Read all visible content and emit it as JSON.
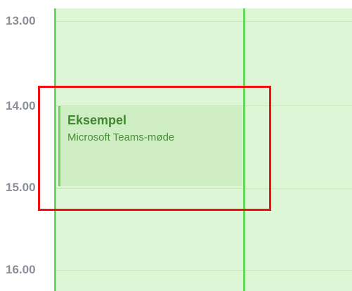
{
  "time_labels": {
    "h13": "13.00",
    "h14": "14.00",
    "h15": "15.00",
    "h16": "16.00"
  },
  "event": {
    "title": "Eksempel",
    "subtitle": "Microsoft Teams-møde"
  },
  "colors": {
    "grid_background": "#dff6d6",
    "day_separator": "#65d95a",
    "event_accent": "#6fd85a",
    "event_text": "#3f8a2f",
    "highlight": "#ef1111"
  }
}
